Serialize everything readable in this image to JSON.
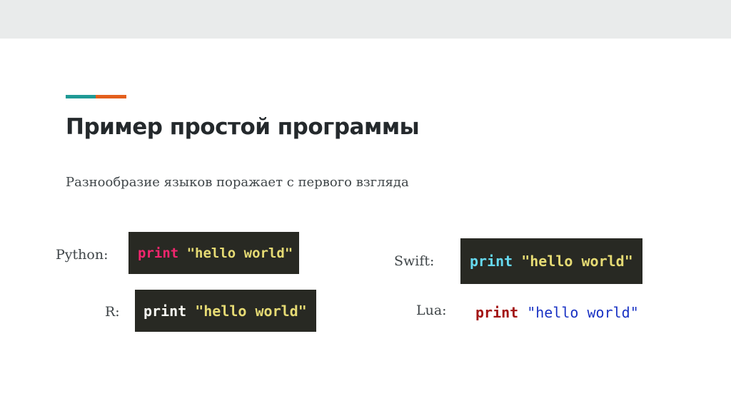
{
  "slide": {
    "title": "Пример простой программы",
    "subtitle": "Разнообразие языков поражает с первого взгляда",
    "accent_colors": [
      "#1f9a95",
      "#e35f1c"
    ]
  },
  "examples": [
    {
      "language": "Python:",
      "keyword": "print",
      "string": "\"hello world\"",
      "keyword_color": "#f2266e",
      "string_color": "#e6db74",
      "background": "#282923"
    },
    {
      "language": "R:",
      "keyword": "print",
      "string": "\"hello world\"",
      "keyword_color": "#f8f8f2",
      "string_color": "#e6db74",
      "background": "#282923"
    },
    {
      "language": "Swift:",
      "keyword": "print",
      "string": "\"hello world\"",
      "keyword_color": "#66d9ef",
      "string_color": "#e6db74",
      "background": "#282923"
    },
    {
      "language": "Lua:",
      "keyword": "print",
      "string": "\"hello world\"",
      "keyword_color": "#a31515",
      "string_color": "#1a33c4",
      "background": "#ffffff"
    }
  ]
}
